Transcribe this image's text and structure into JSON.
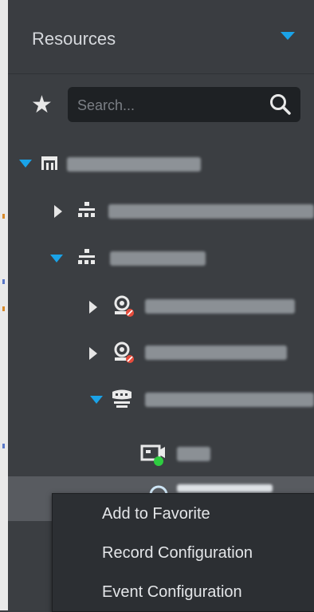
{
  "header": {
    "title": "Resources"
  },
  "search": {
    "placeholder": "Search..."
  },
  "context_menu": {
    "items": [
      {
        "label": "Add to Favorite"
      },
      {
        "label": "Record Configuration"
      },
      {
        "label": "Event Configuration"
      }
    ]
  },
  "colors": {
    "accent": "#1aa3e8",
    "panel_bg": "#3b3e42",
    "search_bg": "#1e2124",
    "selection_bg": "#585b60",
    "menu_bg": "#2c2f33",
    "status_online": "#2ecc40",
    "status_error": "#e74c3c"
  },
  "icons": {
    "favorites": "star-icon",
    "search": "magnifier-icon",
    "root": "organization-root-icon",
    "org": "organization-icon",
    "camera": "camera-icon",
    "nvr": "nvr-device-icon",
    "channel": "video-channel-icon"
  }
}
